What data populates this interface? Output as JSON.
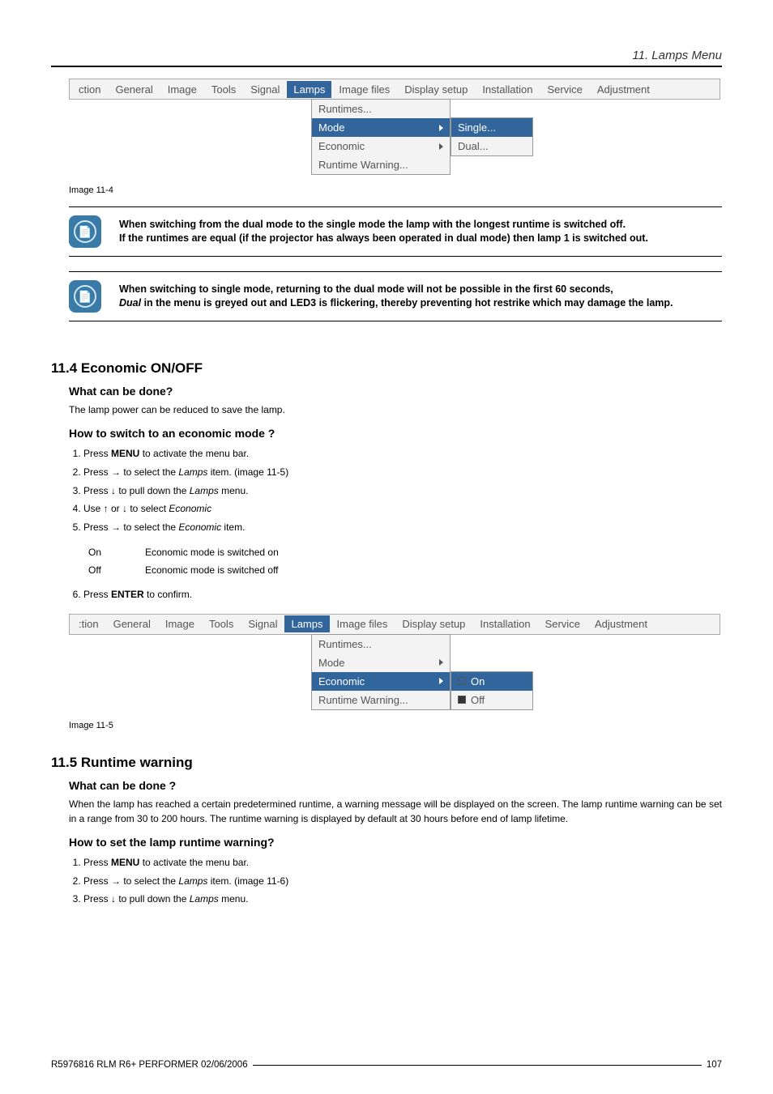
{
  "header": {
    "running_head": "11. Lamps Menu"
  },
  "menu_common": {
    "tabs": [
      "ction",
      "General",
      "Image",
      "Tools",
      "Signal",
      "Lamps",
      "Image files",
      "Display setup",
      "Installation",
      "Service",
      "Adjustment"
    ],
    "tabs2": [
      ":tion",
      "General",
      "Image",
      "Tools",
      "Signal",
      "Lamps",
      "Image files",
      "Display setup",
      "Installation",
      "Service",
      "Adjustment"
    ],
    "selected_tab": "Lamps",
    "lamps_menu": {
      "runtimes": "Runtimes...",
      "mode": "Mode",
      "economic": "Economic",
      "runtime_warning": "Runtime Warning..."
    }
  },
  "figure_11_4": {
    "caption": "Image 11-4",
    "mode_submenu": {
      "single": "Single...",
      "dual": "Dual..."
    }
  },
  "notes": {
    "n1_l1": "When switching from the dual mode to the single mode the lamp with the longest runtime is switched off.",
    "n1_l2": "If the runtimes are equal (if the projector has always been operated in dual mode) then lamp 1 is switched out.",
    "n2_l1": "When switching to single mode, returning to the dual mode will not be possible in the first 60 seconds,",
    "n2_l2_pre": "Dual",
    "n2_l2": " in the menu is greyed out and LED3 is flickering, thereby preventing hot restrike which may damage the lamp."
  },
  "section_11_4": {
    "title": "11.4  Economic ON/OFF",
    "what_heading": "What can be done?",
    "what_body": "The lamp power can be reduced to save the lamp.",
    "how_heading": "How to switch to an economic mode ?",
    "steps": {
      "s1_pre": "Press ",
      "s1_bold": "MENU",
      "s1_post": " to activate the menu bar.",
      "s2_pre": "Press → to select the ",
      "s2_it": "Lamps",
      "s2_post": " item.  (image 11-5)",
      "s3_pre": "Press ↓ to pull down the ",
      "s3_it": "Lamps",
      "s3_post": " menu.",
      "s4": "Use ↑ or ↓ to select ",
      "s4_it": "Economic",
      "s5_pre": "Press → to select the ",
      "s5_it": "Economic",
      "s5_post": " item."
    },
    "options": {
      "on_k": "On",
      "on_v": "Economic mode is switched on",
      "off_k": "Off",
      "off_v": "Economic mode is switched off"
    },
    "confirm_pre": "Press ",
    "confirm_bold": "ENTER",
    "confirm_post": " to confirm."
  },
  "figure_11_5": {
    "caption": "Image 11-5",
    "economic_submenu": {
      "on": "On",
      "off": "Off"
    }
  },
  "section_11_5": {
    "title": "11.5  Runtime warning",
    "what_heading": "What can be done ?",
    "what_body": "When the lamp has reached a certain predetermined runtime, a warning message will be displayed on the screen.  The lamp runtime warning can be set in a range from 30 to 200 hours.  The runtime warning is displayed by default at 30 hours before end of lamp lifetime.",
    "how_heading": "How to set the lamp runtime warning?",
    "steps": {
      "s1_pre": "Press ",
      "s1_bold": "MENU",
      "s1_post": " to activate the menu bar.",
      "s2_pre": "Press → to select the ",
      "s2_it": "Lamps",
      "s2_post": " item.  (image 11-6)",
      "s3_pre": "Press ↓ to pull down the ",
      "s3_it": "Lamps",
      "s3_post": " menu."
    }
  },
  "footer": {
    "left": "R5976816 RLM R6+ PERFORMER  02/06/2006",
    "right": "107"
  }
}
